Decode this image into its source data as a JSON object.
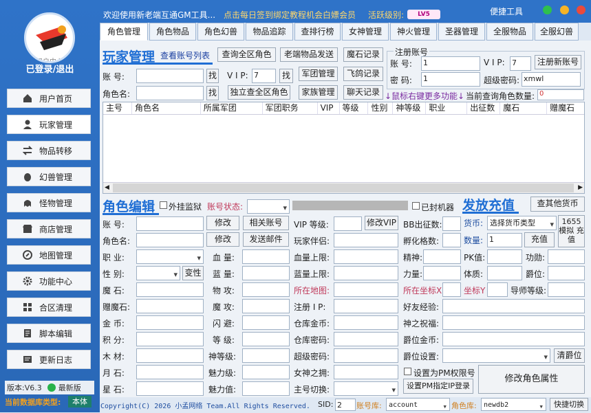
{
  "sidebar": {
    "logo_text": "用户中心",
    "login": "已登录/退出",
    "items": [
      {
        "label": "用户首页",
        "icon": "home-icon"
      },
      {
        "label": "玩家管理",
        "icon": "user-icon"
      },
      {
        "label": "物品转移",
        "icon": "transfer-icon"
      },
      {
        "label": "幻兽管理",
        "icon": "egg-icon"
      },
      {
        "label": "怪物管理",
        "icon": "monster-icon"
      },
      {
        "label": "商店管理",
        "icon": "shop-icon"
      },
      {
        "label": "地图管理",
        "icon": "map-icon"
      },
      {
        "label": "功能中心",
        "icon": "gear-icon"
      },
      {
        "label": "合区清理",
        "icon": "merge-icon"
      },
      {
        "label": "脚本编辑",
        "icon": "script-icon"
      },
      {
        "label": "更新日志",
        "icon": "log-icon"
      }
    ],
    "version": "版本:V6.3",
    "latest": "最新版",
    "db_type_label": "当前数据库类型:",
    "db_type_value": "本体"
  },
  "topbar": {
    "welcome": "欢迎使用新老端互通GM工具...",
    "notice": "点击每日签到绑定教程机会白嫖会员",
    "level_label": "活跃级别:",
    "level_badge": "LV5",
    "quick_tools": "便捷工具"
  },
  "tabs": [
    "角色管理",
    "角色物品",
    "角色幻兽",
    "物品追踪",
    "查排行榜",
    "女神管理",
    "神火管理",
    "圣器管理",
    "全服物品",
    "全服幻兽"
  ],
  "player": {
    "title": "玩家管理",
    "view_list": "查看账号列表",
    "btn_query_all": "查询全区角色",
    "btn_send_old": "老端物品发送",
    "btn_mostone": "魔石记录",
    "btn_army": "军团管理",
    "btn_pigeon": "飞鸽记录",
    "btn_single": "独立查全区角色",
    "btn_family": "家族管理",
    "btn_chat": "聊天记录",
    "account_label": "账    号:",
    "account_value": "",
    "find": "找",
    "vip_label": "V I P:",
    "vip_value": "7",
    "role_label": "角色名:",
    "role_value": "",
    "reg_title": "注册账号",
    "reg_account_label": "账  号:",
    "reg_account": "1",
    "reg_vip_label": "V I P:",
    "reg_vip": "7",
    "reg_btn": "注册新账号",
    "reg_pwd_label": "密  码:",
    "reg_pwd": "1",
    "reg_super_label": "超级密码:",
    "reg_super": "xmwl",
    "hint": "↓鼠标右键更多功能↓",
    "count_label": "当前查询角色数量:",
    "count_value": "0",
    "columns": [
      "主号",
      "角色名",
      "所属军团",
      "军团职务",
      "VIP",
      "等级",
      "性别",
      "神等级",
      "职业",
      "出征数",
      "魔石",
      "赠魔石"
    ]
  },
  "edit": {
    "title": "角色编辑",
    "cheat": "外挂监狱",
    "status_label": "账号状态:",
    "sealed": "已封机器",
    "fields_left": [
      "账    号:",
      "角色名:",
      "职    业:",
      "性    别:",
      "魔    石:",
      "赠魔石:",
      "金    币:",
      "积    分:",
      "木    材:",
      "月    石:",
      "星    石:"
    ],
    "btn_modify": "修改",
    "btn_related": "相关账号",
    "btn_mail": "发送邮件",
    "btn_transgender": "变性",
    "fields_mid": [
      "血    量:",
      "蓝    量:",
      "物    攻:",
      "魔    攻:",
      "闪    避:",
      "等    级:",
      "神等级:",
      "魅力级:",
      "魅力值:"
    ],
    "vip_level": "VIP 等级:",
    "btn_modify_vip": "修改VIP",
    "partner": "玩家伴侣:",
    "hp_max": "血量上限:",
    "mp_max": "蓝量上限:",
    "map": "所在地图:",
    "reg_ip": "注册 I P:",
    "wh_gold": "仓库金币:",
    "wh_pwd": "仓库密码:",
    "super_pwd": "超级密码:",
    "goddess": "女神之拥:",
    "main_switch": "主号切换:",
    "bb_out": "BB出征数:",
    "hatch": "孵化格数:",
    "spirit": "精神:",
    "pk": "PK值:",
    "merit": "功勋:",
    "power": "力量:",
    "stamina": "体质:",
    "rank": "爵位:",
    "pos_x": "所在坐标X",
    "pos_y": "坐标Y",
    "mentor": "导师等级:",
    "friend_exp": "好友经验:",
    "god_bless": "神之祝福:",
    "rank_gold": "爵位金币:",
    "rank_set": "爵位设置:",
    "btn_clear_rank": "清爵位",
    "pm_chk": "设置为PM权限号",
    "btn_pm_ip": "设置PM指定IP登录",
    "btn_modify_attr": "修改角色属性"
  },
  "recharge": {
    "title": "发放充值",
    "btn_other": "查其他货币",
    "currency_label": "货币:",
    "currency_sel": "选择货币类型",
    "btn_1655": "1655 模拟 充值",
    "amount_label": "数量:",
    "amount": "1",
    "btn_recharge": "充值"
  },
  "footer": {
    "copyright": "Copyright(C) 2026 小孟网络 Team.All Rights Reserved.",
    "sid_label": "SID:",
    "sid": "2",
    "acc_db_label": "账号库:",
    "acc_db": "account",
    "role_db_label": "角色库:",
    "role_db": "newdb2",
    "btn_quick": "快捷切换"
  }
}
